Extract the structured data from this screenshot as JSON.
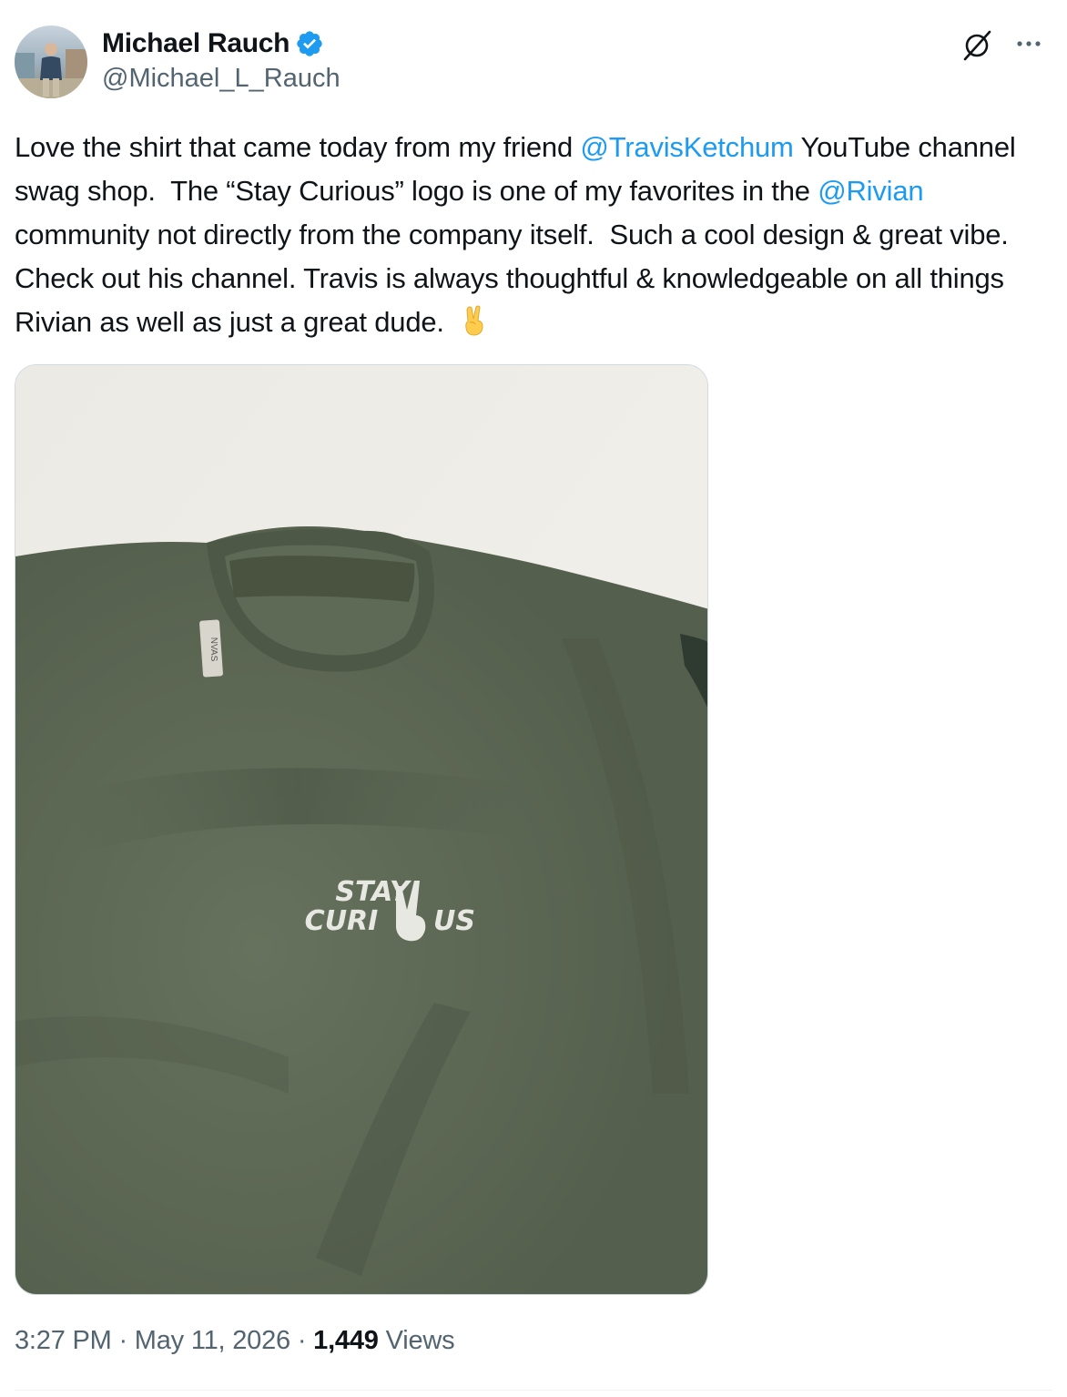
{
  "author": {
    "display_name": "Michael Rauch",
    "handle": "@Michael_L_Rauch",
    "verified": true,
    "verified_color": "#1d9bf0"
  },
  "actions": {
    "grok_icon": "grok-icon",
    "more_icon": "more-icon"
  },
  "tweet": {
    "text_before_mention1": "Love the shirt that came today from my friend ",
    "mention1": "@TravisKetchum",
    "text_after_mention1": " YouTube channel swag shop.  The “Stay Curious” logo is one of my favorites in the ",
    "mention2": "@Rivian",
    "text_after_mention2": " community not directly from the company itself.  Such a cool design & great vibe.  Check out his channel. Travis is always thoughtful & knowledgeable on all things Rivian as well as just a great dude. ",
    "emoji": "✌️",
    "mention_color": "#1d9bf0"
  },
  "media": {
    "description_icon": "tshirt-photo",
    "shirt_logo_line1": "STAY",
    "shirt_logo_line2a": "CURI",
    "shirt_logo_line2b": "US",
    "shirt_tag": "NVAS",
    "shirt_color": "#5b6753"
  },
  "meta": {
    "time": "3:27 PM",
    "separator": " · ",
    "date": "May 11, 2026",
    "views_count": "1,449",
    "views_label": " Views"
  }
}
